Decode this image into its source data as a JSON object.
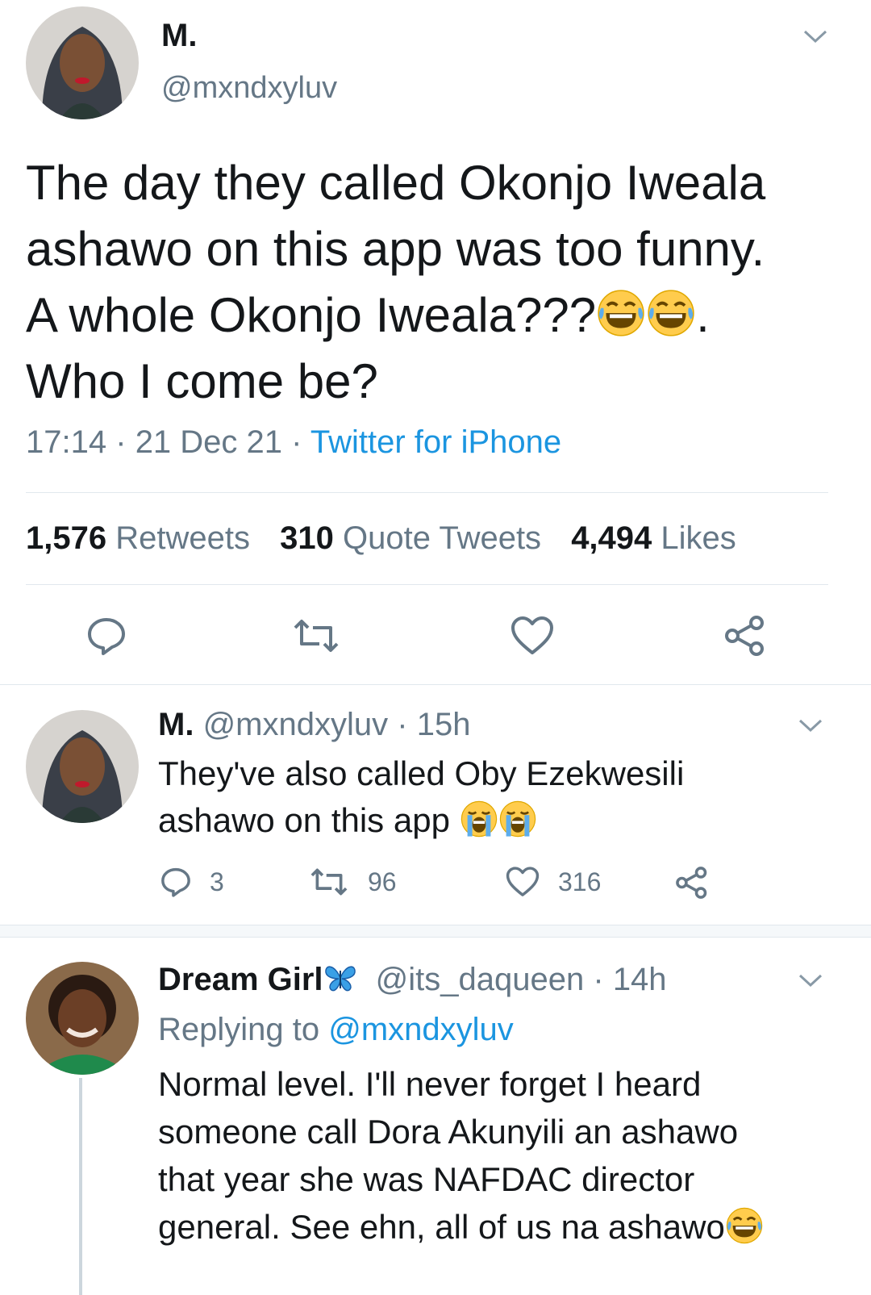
{
  "main_tweet": {
    "display_name": "M.",
    "handle": "@mxndxyluv",
    "text_lines": [
      "The day they called Okonjo Iweala",
      "ashawo on this app was too funny.",
      "A whole Okonjo Iweala???",
      "Who I come be?"
    ],
    "line3_tail": ".",
    "time": "17:14",
    "date": "21 Dec 21",
    "sep": "·",
    "source": "Twitter for iPhone",
    "stats": {
      "retweets_count": "1,576",
      "retweets_label": "Retweets",
      "quotes_count": "310",
      "quotes_label": "Quote Tweets",
      "likes_count": "4,494",
      "likes_label": "Likes"
    }
  },
  "reply_1": {
    "display_name": "M.",
    "handle": "@mxndxyluv",
    "time": "15h",
    "sep": "·",
    "text_lines": [
      "They've also called Oby Ezekwesili",
      "ashawo on this app"
    ],
    "reply_count": "3",
    "retweet_count": "96",
    "like_count": "316"
  },
  "reply_2": {
    "display_name": "Dream Girl",
    "handle": "@its_daqueen",
    "time": "14h",
    "sep": "·",
    "replying_label": "Replying to",
    "replying_handle": "@mxndxyluv",
    "text_lines": [
      "Normal level. I'll never forget I heard",
      "someone call Dora Akunyili an ashawo",
      "that year she was NAFDAC director",
      "general. See ehn, all of us na ashawo"
    ]
  },
  "icons": {
    "chevron": "chevron-down-icon",
    "reply": "reply-icon",
    "retweet": "retweet-icon",
    "like": "heart-icon",
    "share": "share-icon",
    "laugh": "face-with-tears-of-joy-icon",
    "cry": "loudly-crying-face-icon",
    "butterfly": "butterfly-icon"
  },
  "colors": {
    "text": "#14171a",
    "secondary": "#657786",
    "link": "#1b95e0",
    "divider": "#e1e8ed"
  }
}
